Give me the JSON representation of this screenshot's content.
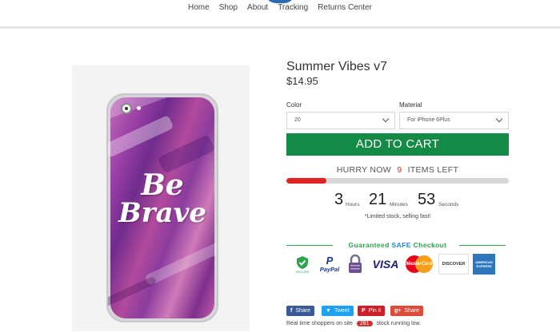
{
  "nav": {
    "items": [
      "Home",
      "Shop",
      "About",
      "Tracking",
      "Returns Center"
    ]
  },
  "product": {
    "title": "Summer Vibes v7",
    "price": "$14.95",
    "image_text_line1": "Be",
    "image_text_line2": "Brave"
  },
  "options": {
    "color_label": "Color",
    "color_value": "20",
    "material_label": "Material",
    "material_value": "For iPhone 6Plus"
  },
  "cart": {
    "label": "ADD TO CART"
  },
  "stock": {
    "prefix": "HURRY NOW",
    "count": "9",
    "suffix": "ITEMS LEFT",
    "progress_fraction": 0.18,
    "note": "*Limited stock, selling fast!"
  },
  "timer": {
    "hours": "3",
    "hours_label": "Hours",
    "minutes": "21",
    "minutes_label": "Minutes",
    "seconds": "53",
    "seconds_label": "Seconds"
  },
  "checkout": {
    "prefix": "Guaranteed",
    "safe": "SAFE",
    "suffix": "Checkout",
    "badges": {
      "ssl": "SECURE",
      "paypal": "PayPal",
      "visa": "VISA",
      "mastercard": "MasterCard",
      "discover": "DISCOVER",
      "amex": "AMERICAN EXPRESS"
    }
  },
  "share": {
    "facebook": "Share",
    "twitter": "Tweet",
    "pinterest": "Pin it",
    "google": "Share"
  },
  "realtime": {
    "prefix": "Real time shoppers on site",
    "count": "281",
    "suffix": "stock running low."
  },
  "colors": {
    "cart_green": "#138a45",
    "alert_red": "#e02424",
    "safe_green": "#2ea44f",
    "safe_blue": "#1e88e5",
    "facebook": "#3b5998",
    "twitter": "#1da1f2",
    "pinterest": "#cb2027",
    "google": "#dd4b39"
  }
}
